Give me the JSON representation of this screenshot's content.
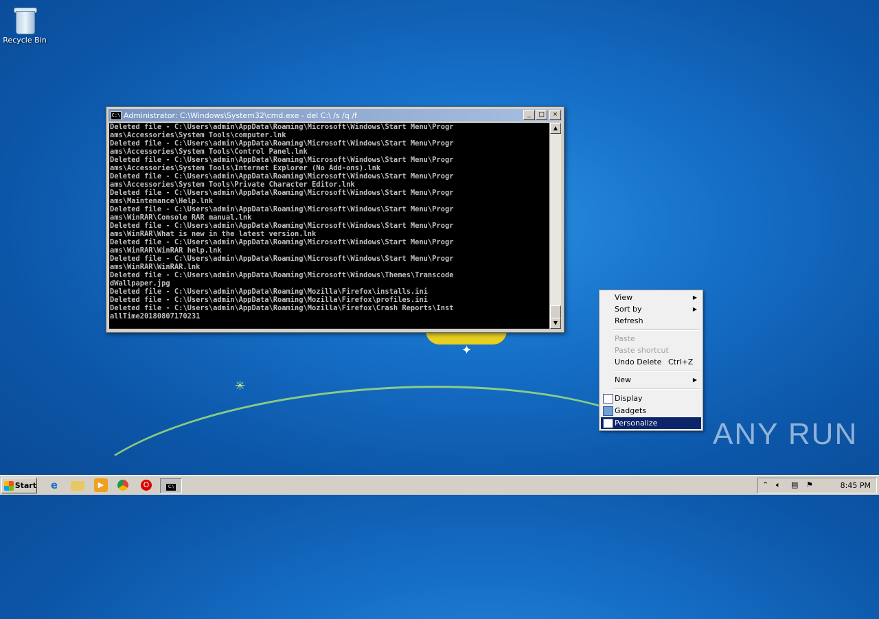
{
  "desktop": {
    "icons": [
      {
        "label": "Recycle Bin",
        "icon": "recycle-bin-icon"
      }
    ],
    "watermark": "ANY RUN"
  },
  "cmd_window": {
    "title": "Administrator: C:\\Windows\\System32\\cmd.exe - del  C:\\ /s /q /f",
    "buttons": {
      "minimize": "_",
      "maximize": "□",
      "close": "×"
    },
    "lines": [
      "Deleted file - C:\\Users\\admin\\AppData\\Roaming\\Microsoft\\Windows\\Start Menu\\Progr",
      "ams\\Accessories\\System Tools\\computer.lnk",
      "Deleted file - C:\\Users\\admin\\AppData\\Roaming\\Microsoft\\Windows\\Start Menu\\Progr",
      "ams\\Accessories\\System Tools\\Control Panel.lnk",
      "Deleted file - C:\\Users\\admin\\AppData\\Roaming\\Microsoft\\Windows\\Start Menu\\Progr",
      "ams\\Accessories\\System Tools\\Internet Explorer (No Add-ons).lnk",
      "Deleted file - C:\\Users\\admin\\AppData\\Roaming\\Microsoft\\Windows\\Start Menu\\Progr",
      "ams\\Accessories\\System Tools\\Private Character Editor.lnk",
      "Deleted file - C:\\Users\\admin\\AppData\\Roaming\\Microsoft\\Windows\\Start Menu\\Progr",
      "ams\\Maintenance\\Help.lnk",
      "Deleted file - C:\\Users\\admin\\AppData\\Roaming\\Microsoft\\Windows\\Start Menu\\Progr",
      "ams\\WinRAR\\Console RAR manual.lnk",
      "Deleted file - C:\\Users\\admin\\AppData\\Roaming\\Microsoft\\Windows\\Start Menu\\Progr",
      "ams\\WinRAR\\What is new in the latest version.lnk",
      "Deleted file - C:\\Users\\admin\\AppData\\Roaming\\Microsoft\\Windows\\Start Menu\\Progr",
      "ams\\WinRAR\\WinRAR help.lnk",
      "Deleted file - C:\\Users\\admin\\AppData\\Roaming\\Microsoft\\Windows\\Start Menu\\Progr",
      "ams\\WinRAR\\WinRAR.lnk",
      "Deleted file - C:\\Users\\admin\\AppData\\Roaming\\Microsoft\\Windows\\Themes\\Transcode",
      "dWallpaper.jpg",
      "Deleted file - C:\\Users\\admin\\AppData\\Roaming\\Mozilla\\Firefox\\installs.ini",
      "Deleted file - C:\\Users\\admin\\AppData\\Roaming\\Mozilla\\Firefox\\profiles.ini",
      "Deleted file - C:\\Users\\admin\\AppData\\Roaming\\Mozilla\\Firefox\\Crash Reports\\Inst",
      "allTime20180807170231"
    ]
  },
  "context_menu": {
    "items": [
      {
        "label": "View",
        "submenu": true
      },
      {
        "label": "Sort by",
        "submenu": true
      },
      {
        "label": "Refresh"
      },
      {
        "label": "Paste",
        "disabled": true
      },
      {
        "label": "Paste shortcut",
        "disabled": true
      },
      {
        "label": "Undo Delete",
        "shortcut": "Ctrl+Z"
      },
      {
        "label": "New",
        "submenu": true
      },
      {
        "label": "Display",
        "icon": "display-icon"
      },
      {
        "label": "Gadgets",
        "icon": "gadgets-icon"
      },
      {
        "label": "Personalize",
        "icon": "personalize-icon",
        "highlighted": true
      }
    ]
  },
  "taskbar": {
    "start_label": "Start",
    "apps": [
      "internet-explorer-icon",
      "file-explorer-icon",
      "media-player-icon",
      "chrome-icon",
      "opera-icon",
      "cmd-icon"
    ],
    "clock": "8:45 PM"
  }
}
